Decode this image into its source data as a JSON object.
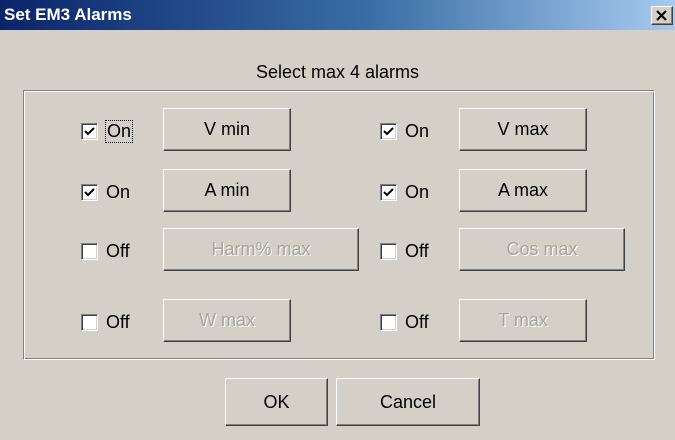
{
  "window": {
    "title": "Set EM3 Alarms"
  },
  "instruction": "Select max 4 alarms",
  "alarms": [
    {
      "state": "On",
      "checked": true,
      "button": "V min",
      "enabled": true
    },
    {
      "state": "On",
      "checked": true,
      "button": "V max",
      "enabled": true
    },
    {
      "state": "On",
      "checked": true,
      "button": "A min",
      "enabled": true
    },
    {
      "state": "On",
      "checked": true,
      "button": "A max",
      "enabled": true
    },
    {
      "state": "Off",
      "checked": false,
      "button": "Harm% max",
      "enabled": false
    },
    {
      "state": "Off",
      "checked": false,
      "button": "Cos max",
      "enabled": false
    },
    {
      "state": "Off",
      "checked": false,
      "button": "W max",
      "enabled": false
    },
    {
      "state": "Off",
      "checked": false,
      "button": "T max",
      "enabled": false
    }
  ],
  "footer": {
    "ok_label": "OK",
    "cancel_label": "Cancel"
  }
}
